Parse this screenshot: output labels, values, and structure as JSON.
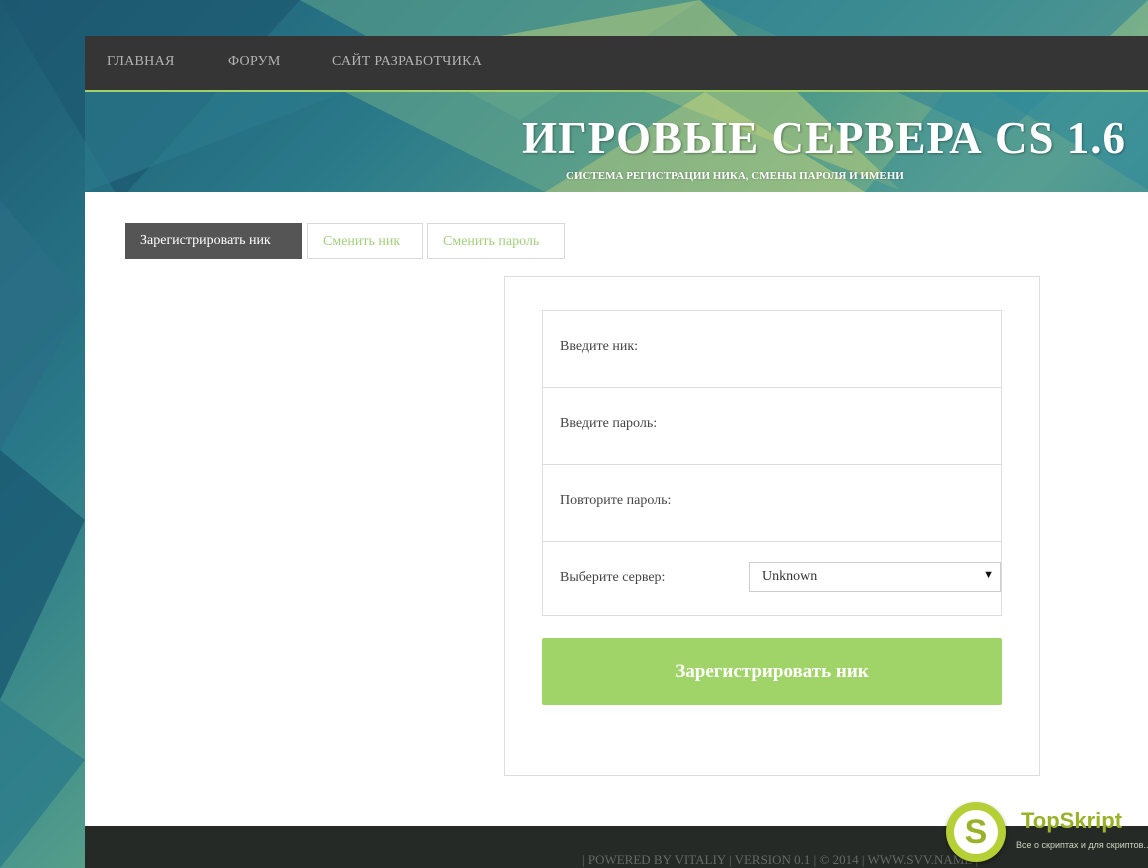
{
  "nav": {
    "items": [
      {
        "label": "ГЛАВНАЯ"
      },
      {
        "label": "ФОРУМ"
      },
      {
        "label": "САЙТ РАЗРАБОТЧИКА"
      }
    ]
  },
  "header": {
    "title": "ИГРОВЫЕ СЕРВЕРА CS 1.6",
    "subtitle": "СИСТЕМА РЕГИСТРАЦИИ НИКА, СМЕНЫ ПАРОЛЯ И ИМЕНИ"
  },
  "tabs": [
    {
      "label": "Зарегистрировать ник",
      "active": true
    },
    {
      "label": "Сменить ник",
      "active": false
    },
    {
      "label": "Сменить пароль",
      "active": false
    }
  ],
  "form": {
    "nick_label": "Введите ник:",
    "password_label": "Введите пароль:",
    "repeat_password_label": "Повторите пароль:",
    "server_label": "Выберите сервер:",
    "server_selected": "Unknown",
    "submit_label": "Зарегистрировать ник"
  },
  "footer": {
    "text": "| POWERED BY VITALIY | VERSION 0.1 | © 2014 | WWW.SVV.NAME |"
  },
  "badge": {
    "letter": "S",
    "name": "TopSkript",
    "tagline": "Все о скриптах и для скриптов..."
  },
  "colors": {
    "accent": "#a0d468",
    "nav_bg": "#353535",
    "active_tab": "#555555",
    "footer_bg": "#262a26"
  }
}
